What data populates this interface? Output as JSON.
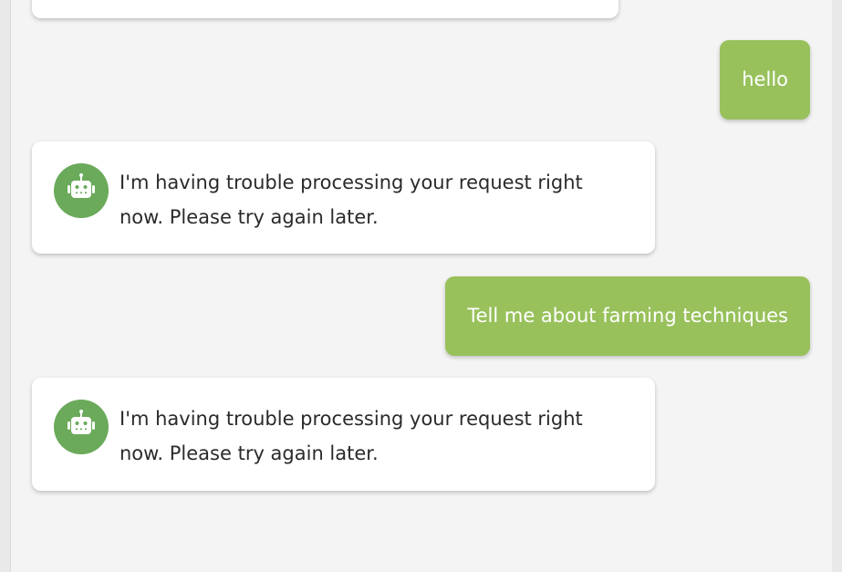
{
  "colors": {
    "background": "#f4f4f4",
    "user_bubble": "#98c15c",
    "bot_bubble": "#ffffff",
    "avatar": "#6aaa5a"
  },
  "avatar_icon": "robot-icon",
  "messages": [
    {
      "sender": "user",
      "text": "hello"
    },
    {
      "sender": "bot",
      "text": "I'm having trouble processing your request right now. Please try again later."
    },
    {
      "sender": "user",
      "text": "Tell me about farming techniques"
    },
    {
      "sender": "bot",
      "text": "I'm having trouble processing your request right now. Please try again later."
    }
  ]
}
